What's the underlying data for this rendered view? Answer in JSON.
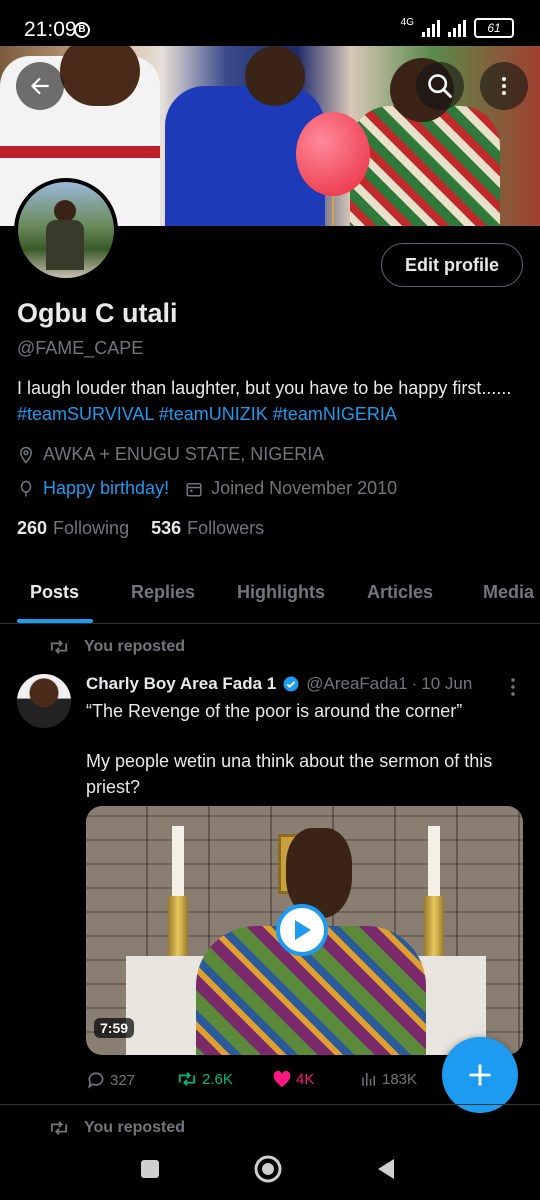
{
  "status_bar": {
    "time": "21:09",
    "badge": "B",
    "network_label": "4G",
    "battery": "61"
  },
  "header": {
    "back_icon": "arrow-left-icon",
    "search_icon": "search-icon",
    "more_icon": "more-vertical-icon"
  },
  "profile": {
    "edit_button": "Edit profile",
    "name": "Ogbu C utali",
    "handle": "@FAME_CAPE",
    "bio_text": "I laugh louder than laughter, but you have to be happy first...... ",
    "bio_tags": [
      "#teamSURVIVAL",
      "#teamUNIZIK",
      "#teamNIGERIA"
    ],
    "location": "AWKA + ENUGU STATE, NIGERIA",
    "birthday": "Happy birthday!",
    "joined": "Joined November 2010",
    "following_count": "260",
    "following_label": "Following",
    "followers_count": "536",
    "followers_label": "Followers"
  },
  "tabs": [
    {
      "label": "Posts",
      "active": true
    },
    {
      "label": "Replies",
      "active": false
    },
    {
      "label": "Highlights",
      "active": false
    },
    {
      "label": "Articles",
      "active": false
    },
    {
      "label": "Media",
      "active": false
    }
  ],
  "post": {
    "repost_label": "You reposted",
    "author": "Charly Boy Area Fada 1",
    "author_handle": "@AreaFada1",
    "separator": "·",
    "date": "10 Jun",
    "text_line1": "“The Revenge of the poor is around the corner”",
    "text_line2": "My people wetin una think about the sermon of this priest?",
    "video_duration": "7:59",
    "reply_count": "327",
    "repost_count": "2.6K",
    "like_count": "4K",
    "view_count": "183K"
  },
  "next_post": {
    "repost_label": "You reposted"
  },
  "colors": {
    "accent": "#1d9bf0",
    "repost_green": "#00ba7c",
    "like_pink": "#f91880",
    "muted": "#71767b"
  }
}
